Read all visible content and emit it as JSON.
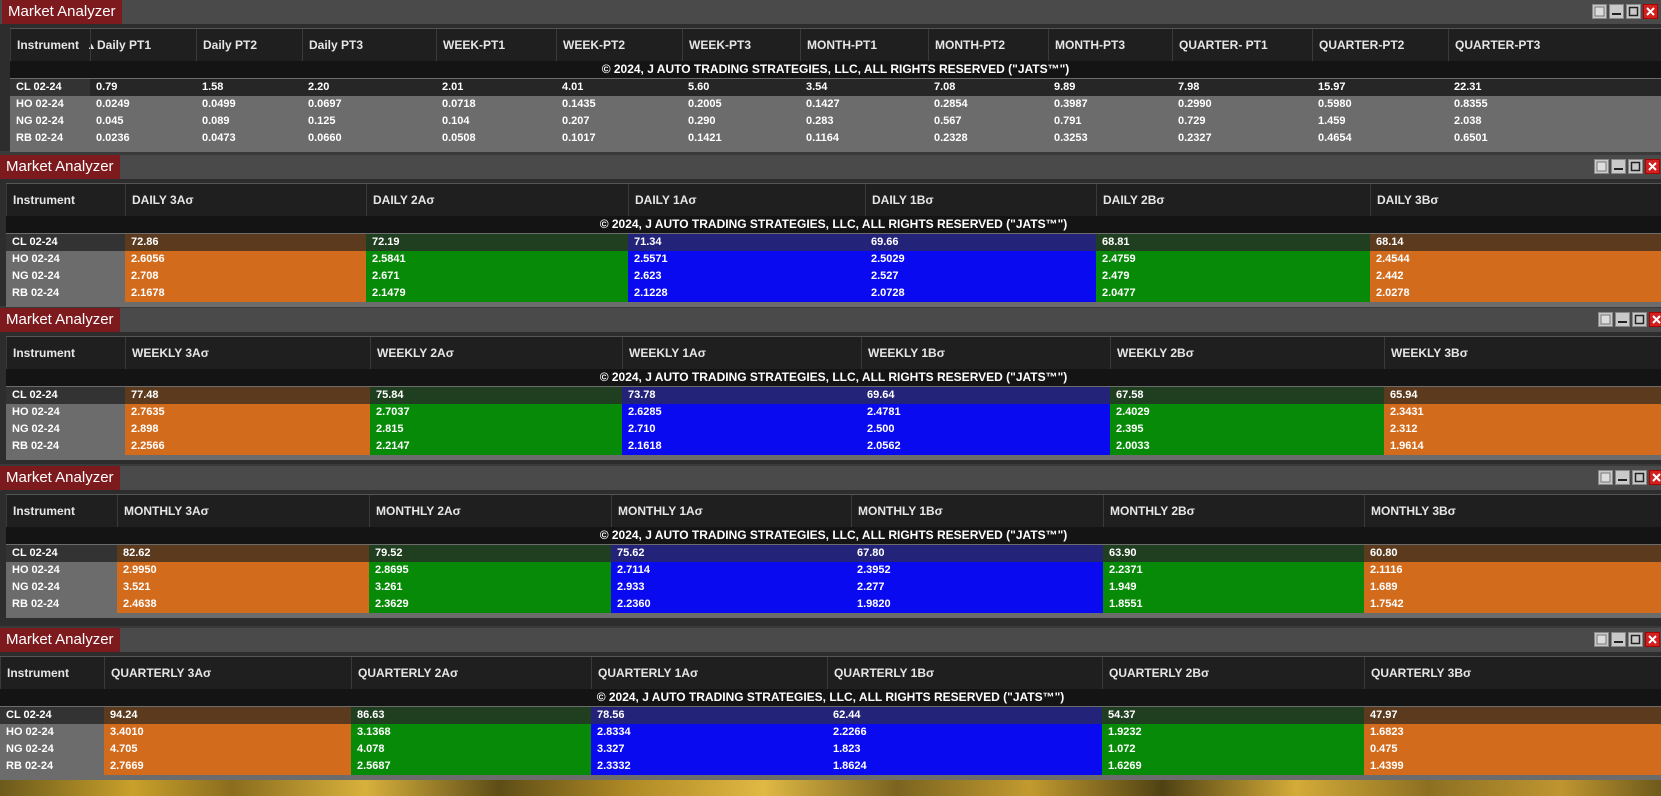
{
  "colors": {
    "orange": "#d26b1c",
    "green": "#078a07",
    "blue": "#0a0af0",
    "cl_orange": "#5c3a1e",
    "cl_green": "#203f20",
    "cl_blue": "#23237a",
    "title_red": "#7c1a1d"
  },
  "copyright": "© 2024, J AUTO TRADING STRATEGIES, LLC, ALL RIGHTS RESERVED (\"JATS™\")",
  "windows": [
    {
      "title": "Market Analyzer",
      "columns": [
        "Instrument",
        "Daily PT1",
        "Daily PT2",
        "Daily PT3",
        "WEEK-PT1",
        "WEEK-PT2",
        "WEEK-PT3",
        "MONTH-PT1",
        "MONTH-PT2",
        "MONTH-PT3",
        "QUARTER- PT1",
        "QUARTER-PT2",
        "QUARTER-PT3"
      ],
      "rows": [
        {
          "instrument": "CL 02-24",
          "values": [
            "0.79",
            "1.58",
            "2.20",
            "2.01",
            "4.01",
            "5.60",
            "3.54",
            "7.08",
            "9.89",
            "7.98",
            "15.97",
            "22.31"
          ]
        },
        {
          "instrument": "HO 02-24",
          "values": [
            "0.0249",
            "0.0499",
            "0.0697",
            "0.0718",
            "0.1435",
            "0.2005",
            "0.1427",
            "0.2854",
            "0.3987",
            "0.2990",
            "0.5980",
            "0.8355"
          ]
        },
        {
          "instrument": "NG 02-24",
          "values": [
            "0.045",
            "0.089",
            "0.125",
            "0.104",
            "0.207",
            "0.290",
            "0.283",
            "0.567",
            "0.791",
            "0.729",
            "1.459",
            "2.038"
          ]
        },
        {
          "instrument": "RB 02-24",
          "values": [
            "0.0236",
            "0.0473",
            "0.0660",
            "0.0508",
            "0.1017",
            "0.1421",
            "0.1164",
            "0.2328",
            "0.3253",
            "0.2327",
            "0.4654",
            "0.6501"
          ]
        }
      ]
    },
    {
      "title": "Market Analyzer",
      "columns": [
        "Instrument",
        "DAILY 3Aσ",
        "DAILY 2Aσ",
        "DAILY 1Aσ",
        "DAILY 1Bσ",
        "DAILY 2Bσ",
        "DAILY 3Bσ"
      ],
      "rows": [
        {
          "instrument": "CL 02-24",
          "values": [
            "72.86",
            "72.19",
            "71.34",
            "69.66",
            "68.81",
            "68.14"
          ]
        },
        {
          "instrument": "HO 02-24",
          "values": [
            "2.6056",
            "2.5841",
            "2.5571",
            "2.5029",
            "2.4759",
            "2.4544"
          ]
        },
        {
          "instrument": "NG 02-24",
          "values": [
            "2.708",
            "2.671",
            "2.623",
            "2.527",
            "2.479",
            "2.442"
          ]
        },
        {
          "instrument": "RB 02-24",
          "values": [
            "2.1678",
            "2.1479",
            "2.1228",
            "2.0728",
            "2.0477",
            "2.0278"
          ]
        }
      ]
    },
    {
      "title": "Market Analyzer",
      "columns": [
        "Instrument",
        "WEEKLY 3Aσ",
        "WEEKLY 2Aσ",
        "WEEKLY 1Aσ",
        "WEEKLY 1Bσ",
        "WEEKLY 2Bσ",
        "WEEKLY 3Bσ"
      ],
      "rows": [
        {
          "instrument": "CL 02-24",
          "values": [
            "77.48",
            "75.84",
            "73.78",
            "69.64",
            "67.58",
            "65.94"
          ]
        },
        {
          "instrument": "HO 02-24",
          "values": [
            "2.7635",
            "2.7037",
            "2.6285",
            "2.4781",
            "2.4029",
            "2.3431"
          ]
        },
        {
          "instrument": "NG 02-24",
          "values": [
            "2.898",
            "2.815",
            "2.710",
            "2.500",
            "2.395",
            "2.312"
          ]
        },
        {
          "instrument": "RB 02-24",
          "values": [
            "2.2566",
            "2.2147",
            "2.1618",
            "2.0562",
            "2.0033",
            "1.9614"
          ]
        }
      ]
    },
    {
      "title": "Market Analyzer",
      "columns": [
        "Instrument",
        "MONTHLY 3Aσ",
        "MONTHLY 2Aσ",
        "MONTHLY 1Aσ",
        "MONTHLY 1Bσ",
        "MONTHLY 2Bσ",
        "MONTHLY 3Bσ"
      ],
      "rows": [
        {
          "instrument": "CL 02-24",
          "values": [
            "82.62",
            "79.52",
            "75.62",
            "67.80",
            "63.90",
            "60.80"
          ]
        },
        {
          "instrument": "HO 02-24",
          "values": [
            "2.9950",
            "2.8695",
            "2.7114",
            "2.3952",
            "2.2371",
            "2.1116"
          ]
        },
        {
          "instrument": "NG 02-24",
          "values": [
            "3.521",
            "3.261",
            "2.933",
            "2.277",
            "1.949",
            "1.689"
          ]
        },
        {
          "instrument": "RB 02-24",
          "values": [
            "2.4638",
            "2.3629",
            "2.2360",
            "1.9820",
            "1.8551",
            "1.7542"
          ]
        }
      ]
    },
    {
      "title": "Market Analyzer",
      "columns": [
        "Instrument",
        "QUARTERLY 3Aσ",
        "QUARTERLY 2Aσ",
        "QUARTERLY 1Aσ",
        "QUARTERLY 1Bσ",
        "QUARTERLY 2Bσ",
        "QUARTERLY 3Bσ"
      ],
      "rows": [
        {
          "instrument": "CL 02-24",
          "values": [
            "94.24",
            "86.63",
            "78.56",
            "62.44",
            "54.37",
            "47.97"
          ]
        },
        {
          "instrument": "HO 02-24",
          "values": [
            "3.4010",
            "3.1368",
            "2.8334",
            "2.2266",
            "1.9232",
            "1.6823"
          ]
        },
        {
          "instrument": "NG 02-24",
          "values": [
            "4.705",
            "4.078",
            "3.327",
            "1.823",
            "1.072",
            "0.475"
          ]
        },
        {
          "instrument": "RB 02-24",
          "values": [
            "2.7669",
            "2.5687",
            "2.3332",
            "1.8624",
            "1.6269",
            "1.4399"
          ]
        }
      ]
    }
  ]
}
